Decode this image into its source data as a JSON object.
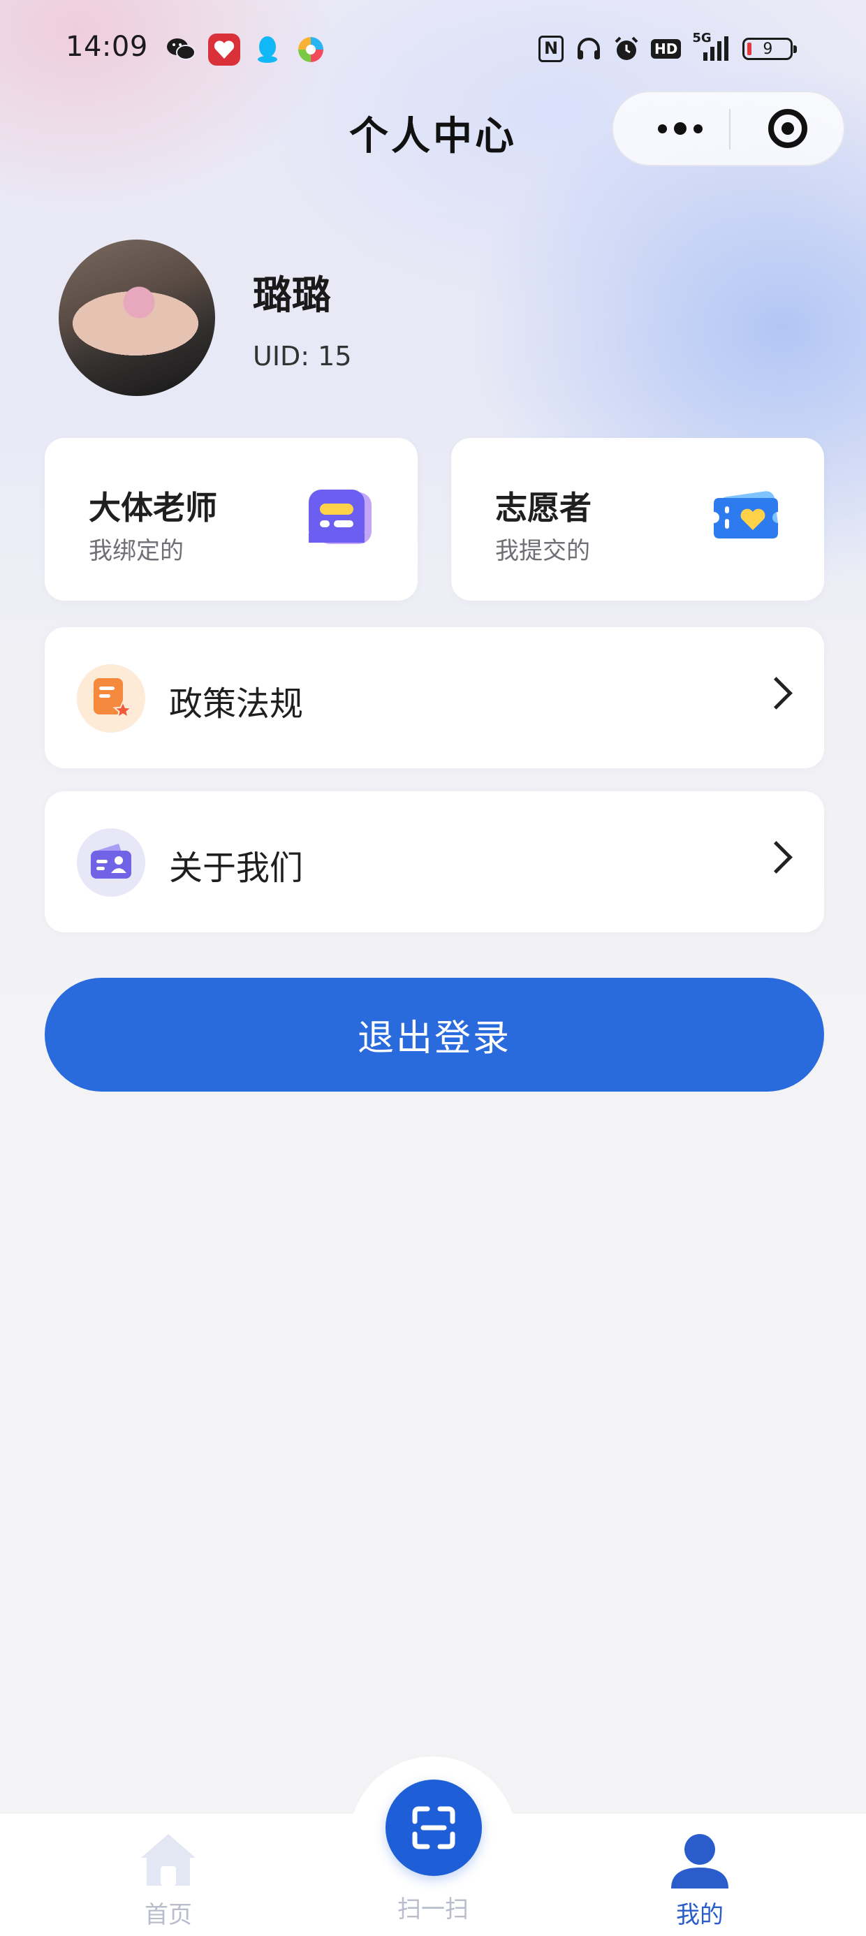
{
  "status_bar": {
    "time": "14:09",
    "notification_icons": [
      "wechat-icon",
      "app-red-icon",
      "qq-icon",
      "colorful-app-icon"
    ],
    "system_icons": [
      "nfc-icon",
      "headphones-icon",
      "alarm-icon",
      "hd-icon",
      "5g-signal-icon"
    ],
    "signal_label": "5G",
    "hd_label": "HD",
    "nfc_label": "N",
    "battery_level": "9"
  },
  "nav": {
    "title": "个人中心"
  },
  "profile": {
    "name": "璐璐",
    "uid": "UID: 15"
  },
  "quick_cards": [
    {
      "title": "大体老师",
      "subtitle": "我绑定的",
      "icon": "ticket-purple-icon"
    },
    {
      "title": "志愿者",
      "subtitle": "我提交的",
      "icon": "heart-ticket-icon"
    }
  ],
  "menu": [
    {
      "label": "政策法规",
      "icon": "policy-document-icon"
    },
    {
      "label": "关于我们",
      "icon": "about-card-icon"
    }
  ],
  "logout_label": "退出登录",
  "tabbar": {
    "items": [
      {
        "label": "首页",
        "icon": "home-icon",
        "active": false
      },
      {
        "label": "扫一扫",
        "icon": "scan-icon",
        "active": false
      },
      {
        "label": "我的",
        "icon": "user-icon",
        "active": true
      }
    ]
  },
  "colors": {
    "primary": "#296add",
    "tab_active": "#2a5ccc",
    "tab_inactive": "#b8bccb"
  }
}
